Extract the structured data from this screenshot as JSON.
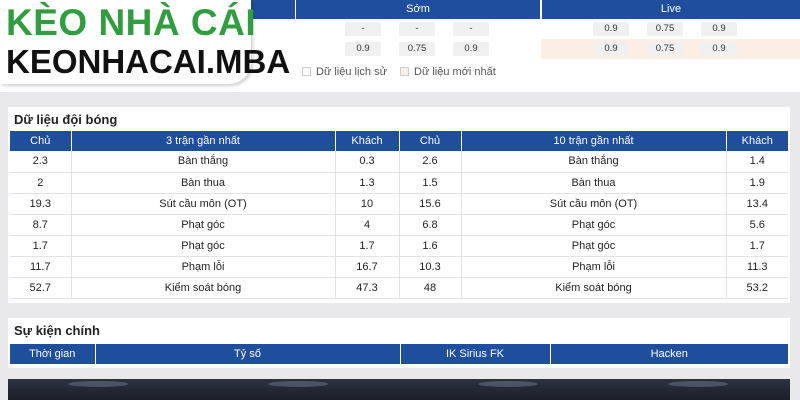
{
  "logo": {
    "line1": "KÈO NHÀ CÁI",
    "line2": "KEONHACAI.MBA",
    "brand_color": "#2f9e3e"
  },
  "odds": {
    "early_label": "Sớm",
    "live_label": "Live",
    "rows": [
      {
        "early": [
          "-",
          "-",
          "-"
        ],
        "live": [
          "0.9",
          "0.75",
          "0.9"
        ]
      },
      {
        "early": [
          "0.9",
          "0.75",
          "0.9"
        ],
        "live": [
          "0.9",
          "0.75",
          "0.9"
        ]
      }
    ],
    "legend_history": "Dữ liệu lịch sử",
    "legend_latest": "Dữ liệu mới nhất"
  },
  "team_data": {
    "title": "Dữ liệu đội bóng",
    "headers": [
      "Chủ",
      "3 trận gần nhất",
      "Khách",
      "Chủ",
      "10 trận gần nhất",
      "Khách"
    ],
    "rows": [
      [
        "2.3",
        "Bàn thắng",
        "0.3",
        "2.6",
        "Bàn thắng",
        "1.4"
      ],
      [
        "2",
        "Bàn thua",
        "1.3",
        "1.5",
        "Bàn thua",
        "1.9"
      ],
      [
        "19.3",
        "Sút cầu môn (OT)",
        "10",
        "15.6",
        "Sút cầu môn (OT)",
        "13.4"
      ],
      [
        "8.7",
        "Phạt góc",
        "4",
        "6.8",
        "Phạt góc",
        "5.6"
      ],
      [
        "1.7",
        "Phạt góc",
        "1.7",
        "1.6",
        "Phạt góc",
        "1.7"
      ],
      [
        "11.7",
        "Phạm lỗi",
        "16.7",
        "10.3",
        "Phạm lỗi",
        "11.3"
      ],
      [
        "52.7",
        "Kiểm soát bóng",
        "47.3",
        "48",
        "Kiểm soát bóng",
        "53.2"
      ]
    ]
  },
  "events": {
    "title": "Sự kiện chính",
    "headers": [
      "Thời gian",
      "Tỷ số",
      "IK Sirius FK",
      "Hacken"
    ]
  },
  "colors": {
    "header_blue": "#1f4e9c",
    "live_bg": "#fdeee4"
  }
}
